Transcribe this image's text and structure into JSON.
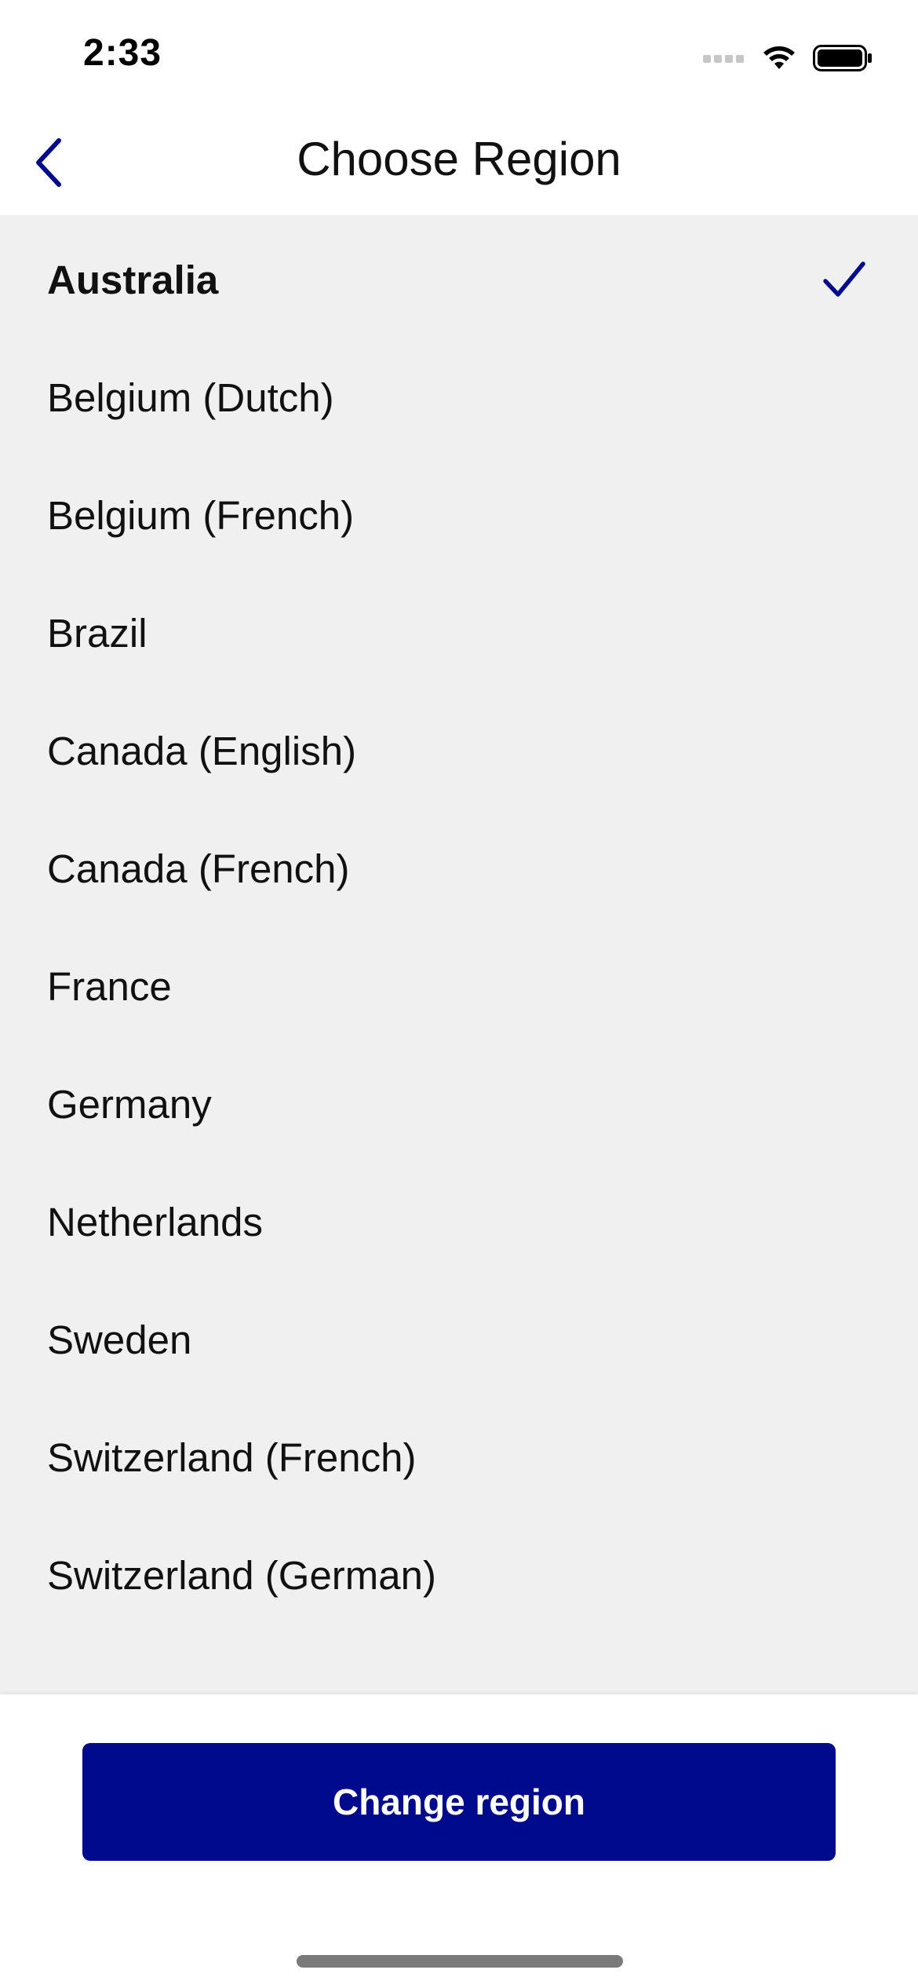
{
  "status_bar": {
    "time": "2:33"
  },
  "header": {
    "title": "Choose Region",
    "back_icon": "chevron-left-icon"
  },
  "regions": {
    "items": [
      {
        "label": "Australia",
        "selected": true
      },
      {
        "label": "Belgium (Dutch)",
        "selected": false
      },
      {
        "label": "Belgium (French)",
        "selected": false
      },
      {
        "label": "Brazil",
        "selected": false
      },
      {
        "label": "Canada (English)",
        "selected": false
      },
      {
        "label": "Canada (French)",
        "selected": false
      },
      {
        "label": "France",
        "selected": false
      },
      {
        "label": "Germany",
        "selected": false
      },
      {
        "label": "Netherlands",
        "selected": false
      },
      {
        "label": "Sweden",
        "selected": false
      },
      {
        "label": "Switzerland (French)",
        "selected": false
      },
      {
        "label": "Switzerland (German)",
        "selected": false
      }
    ],
    "selected_icon": "checkmark-icon"
  },
  "footer": {
    "button_label": "Change region"
  },
  "colors": {
    "accent": "#000a8c",
    "list_background": "#f0f0f0",
    "text": "#111111"
  }
}
